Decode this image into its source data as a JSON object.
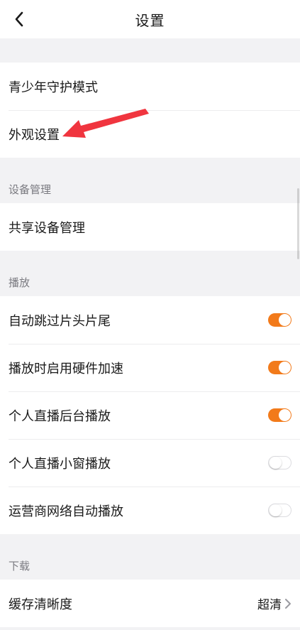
{
  "nav": {
    "title": "设置",
    "back_icon": "chevron-left-icon"
  },
  "groups": {
    "top": {
      "items": [
        {
          "label": "青少年守护模式"
        },
        {
          "label": "外观设置"
        }
      ]
    },
    "device": {
      "header": "设备管理",
      "items": [
        {
          "label": "共享设备管理"
        }
      ]
    },
    "playback": {
      "header": "播放",
      "items": [
        {
          "label": "自动跳过片头片尾",
          "enabled": true
        },
        {
          "label": "播放时启用硬件加速",
          "enabled": true
        },
        {
          "label": "个人直播后台播放",
          "enabled": true
        },
        {
          "label": "个人直播小窗播放",
          "enabled": false
        },
        {
          "label": "运营商网络自动播放",
          "enabled": false
        }
      ]
    },
    "download": {
      "header": "下载",
      "items": [
        {
          "label": "缓存清晰度",
          "value": "超清"
        }
      ]
    }
  },
  "colors": {
    "toggle_on": "#f27a1a",
    "annotation_arrow": "#f0353f",
    "background": "#f2f2f4"
  }
}
